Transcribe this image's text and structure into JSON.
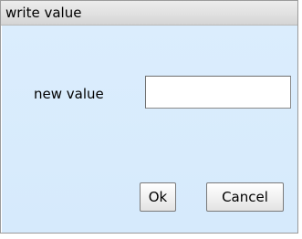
{
  "dialog": {
    "title": "write value",
    "field_label": "new value",
    "input_value": "",
    "buttons": {
      "ok_label": "Ok",
      "cancel_label": "Cancel"
    }
  },
  "colors": {
    "dialog_background": "#d4e8fb",
    "titlebar_background": "#e1e1e1",
    "input_background": "#ffffff"
  }
}
